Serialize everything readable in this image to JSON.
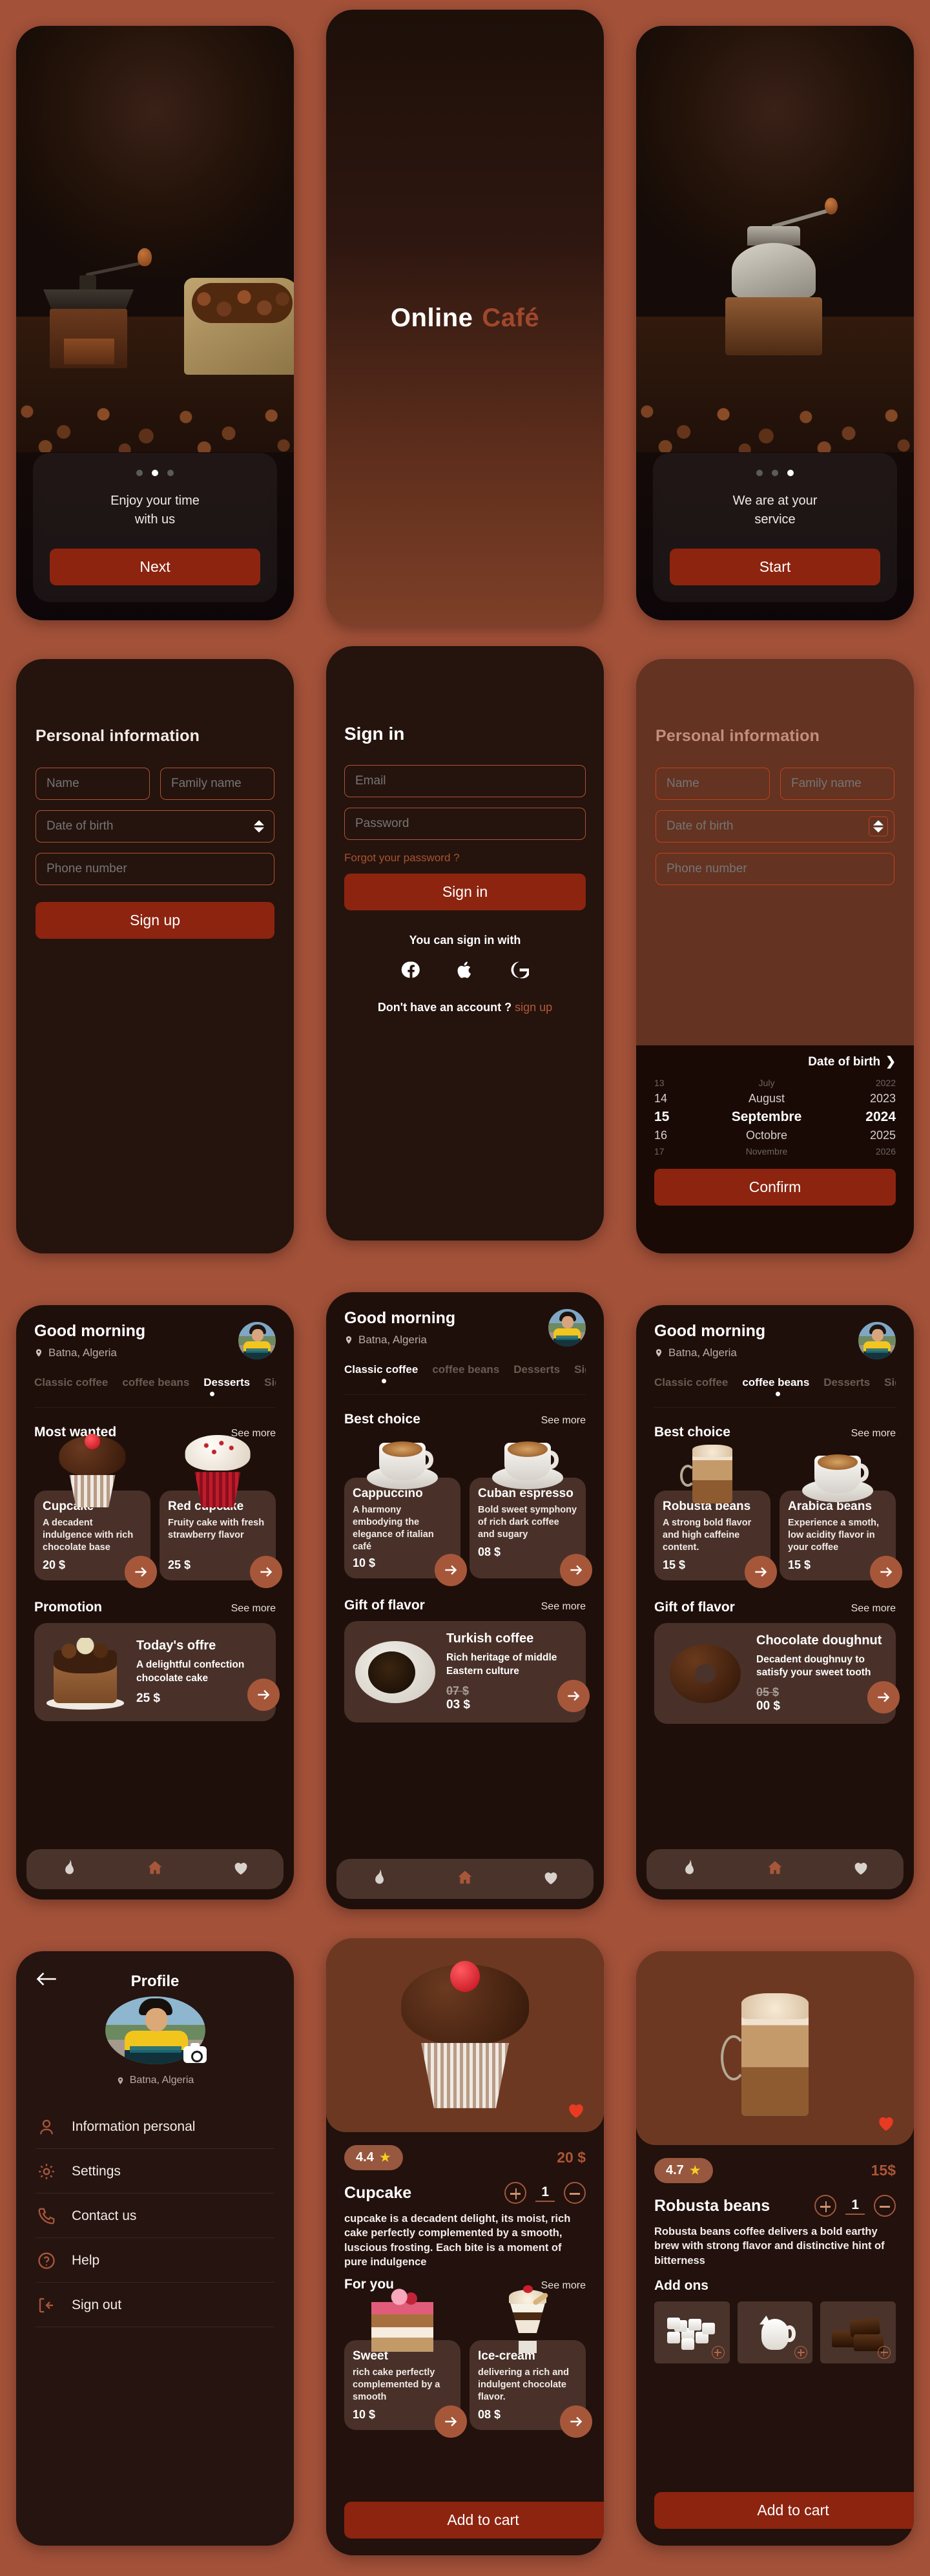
{
  "background_color": "#a35139",
  "accent": {
    "primary_button": "#8c2410",
    "accent_brown": "#a6573a",
    "card": "#493129",
    "border": "#b05434",
    "heart_red": "#e93a22",
    "star_yellow": "#f5cf20"
  },
  "onboarding_1": {
    "dots": 3,
    "active_dot": 2,
    "text_line1": "Enjoy your time",
    "text_line2": "with us",
    "button": "Next"
  },
  "splash": {
    "title_word1": "Online",
    "title_word2": "Café"
  },
  "onboarding_3": {
    "dots": 3,
    "active_dot": 3,
    "text_line1": "We are at your",
    "text_line2": "service",
    "button": "Start"
  },
  "signup": {
    "title": "Personal information",
    "name_placeholder": "Name",
    "family_name_placeholder": "Family name",
    "dob_placeholder": "Date of birth",
    "phone_placeholder": "Phone number",
    "button": "Sign up"
  },
  "signin": {
    "title": "Sign in",
    "email_placeholder": "Email",
    "password_placeholder": "Password",
    "forgot": "Forgot your password ?",
    "button": "Sign in",
    "social_prompt": "You can sign in with",
    "socials": [
      "facebook-icon",
      "apple-icon",
      "google-icon"
    ],
    "no_account": "Don't have an account ?",
    "signup_link": "sign up"
  },
  "datepicker": {
    "title": "Personal information",
    "name_placeholder": "Name",
    "family_name_placeholder": "Family name",
    "dob_placeholder": "Date of birth",
    "phone_placeholder": "Phone number",
    "picker_header": "Date of birth",
    "rows": [
      {
        "day": "13",
        "month": "July",
        "year": "2022",
        "state": "far"
      },
      {
        "day": "14",
        "month": "August",
        "year": "2023",
        "state": "near"
      },
      {
        "day": "15",
        "month": "Septembre",
        "year": "2024",
        "state": "sel"
      },
      {
        "day": "16",
        "month": "Octobre",
        "year": "2025",
        "state": "near"
      },
      {
        "day": "17",
        "month": "Novembre",
        "year": "2026",
        "state": "far"
      }
    ],
    "confirm": "Confirm"
  },
  "home_common": {
    "greeting": "Good morning",
    "location": "Batna, Algeria",
    "tabs": [
      "Classic coffee",
      "coffee beans",
      "Desserts",
      "Signature"
    ],
    "see_more": "See more",
    "nav": [
      "flame-icon",
      "home-icon",
      "heart-icon"
    ]
  },
  "home_desserts": {
    "active_tab": "Desserts",
    "section1_title": "Most wanted",
    "cards": [
      {
        "name": "Cupcake",
        "desc": "A decadent indulgence with rich chocolate base",
        "price": "20 $",
        "illustration": "cupcake"
      },
      {
        "name": "Red cupcake",
        "desc": "Fruity cake with fresh strawberry flavor",
        "price": "25 $",
        "illustration": "red-cupcake"
      }
    ],
    "section2_title": "Promotion",
    "promo": {
      "name": "Today's offre",
      "desc": "A delightful confection chocolate cake",
      "price": "25 $",
      "old_price": "",
      "illustration": "chocolate-cake"
    }
  },
  "home_classic": {
    "active_tab": "Classic coffee",
    "section1_title": "Best choice",
    "cards": [
      {
        "name": "Cappuccino",
        "desc": "A  harmony embodying the elegance of italian café",
        "price": "10 $",
        "illustration": "cappuccino"
      },
      {
        "name": "Cuban espresso",
        "desc": "Bold sweet symphony of rich dark coffee and sugary",
        "price": "08 $",
        "illustration": "espresso"
      }
    ],
    "section2_title": "Gift of flavor",
    "promo": {
      "name": "Turkish coffee",
      "desc": "Rich heritage of middle Eastern culture",
      "old_price": "07 $",
      "price": "03 $",
      "illustration": "turkish-coffee"
    }
  },
  "home_beans": {
    "active_tab": "coffee beans",
    "section1_title": "Best choice",
    "cards": [
      {
        "name": "Robusta beans",
        "desc": "A strong bold flavor and high caffeine content.",
        "price": "15 $",
        "illustration": "latte-glass"
      },
      {
        "name": "Arabica beans",
        "desc": "Experience a smoth, low acidity flavor in your coffee",
        "price": "15 $",
        "illustration": "coffee-cup"
      }
    ],
    "section2_title": "Gift of flavor",
    "promo": {
      "name": "Chocolate doughnut",
      "desc": "Decadent doughnuy to satisfy your sweet tooth",
      "old_price": "05 $",
      "price": "00 $",
      "illustration": "doughnut"
    }
  },
  "profile": {
    "title": "Profile",
    "location": "Batna, Algeria",
    "menu": [
      {
        "label": "Information personal",
        "icon": "user-icon"
      },
      {
        "label": "Settings",
        "icon": "gear-icon"
      },
      {
        "label": "Contact us",
        "icon": "phone-icon"
      },
      {
        "label": "Help",
        "icon": "question-circle-icon"
      },
      {
        "label": "Sign out",
        "icon": "logout-icon"
      }
    ]
  },
  "detail_cupcake": {
    "rating": "4.4",
    "price": "20 $",
    "name": "Cupcake",
    "quantity": "1",
    "description": "cupcake is a decadent delight, its moist, rich cake perfectly complemented by a smooth, luscious frosting. Each bite is a moment of pure indulgence",
    "section_title": "For you",
    "see_more": "See more",
    "related": [
      {
        "name": "Sweet",
        "desc": "rich cake perfectly complemented by a smooth",
        "price": "10 $",
        "illustration": "sweet-cake"
      },
      {
        "name": "Ice-cream",
        "desc": "delivering a rich and indulgent chocolate flavor.",
        "price": "08 $",
        "illustration": "ice-cream"
      }
    ],
    "cta": "Add to cart"
  },
  "detail_robusta": {
    "rating": "4.7",
    "price": "15$",
    "name": "Robusta beans",
    "quantity": "1",
    "description": "Robusta beans coffee delivers a bold earthy brew with strong flavor and distinctive hint of bitterness",
    "section_title": "Add ons",
    "addons": [
      "sugar-cubes",
      "milk-jug",
      "chocolate-bars"
    ],
    "cta": "Add to cart"
  }
}
